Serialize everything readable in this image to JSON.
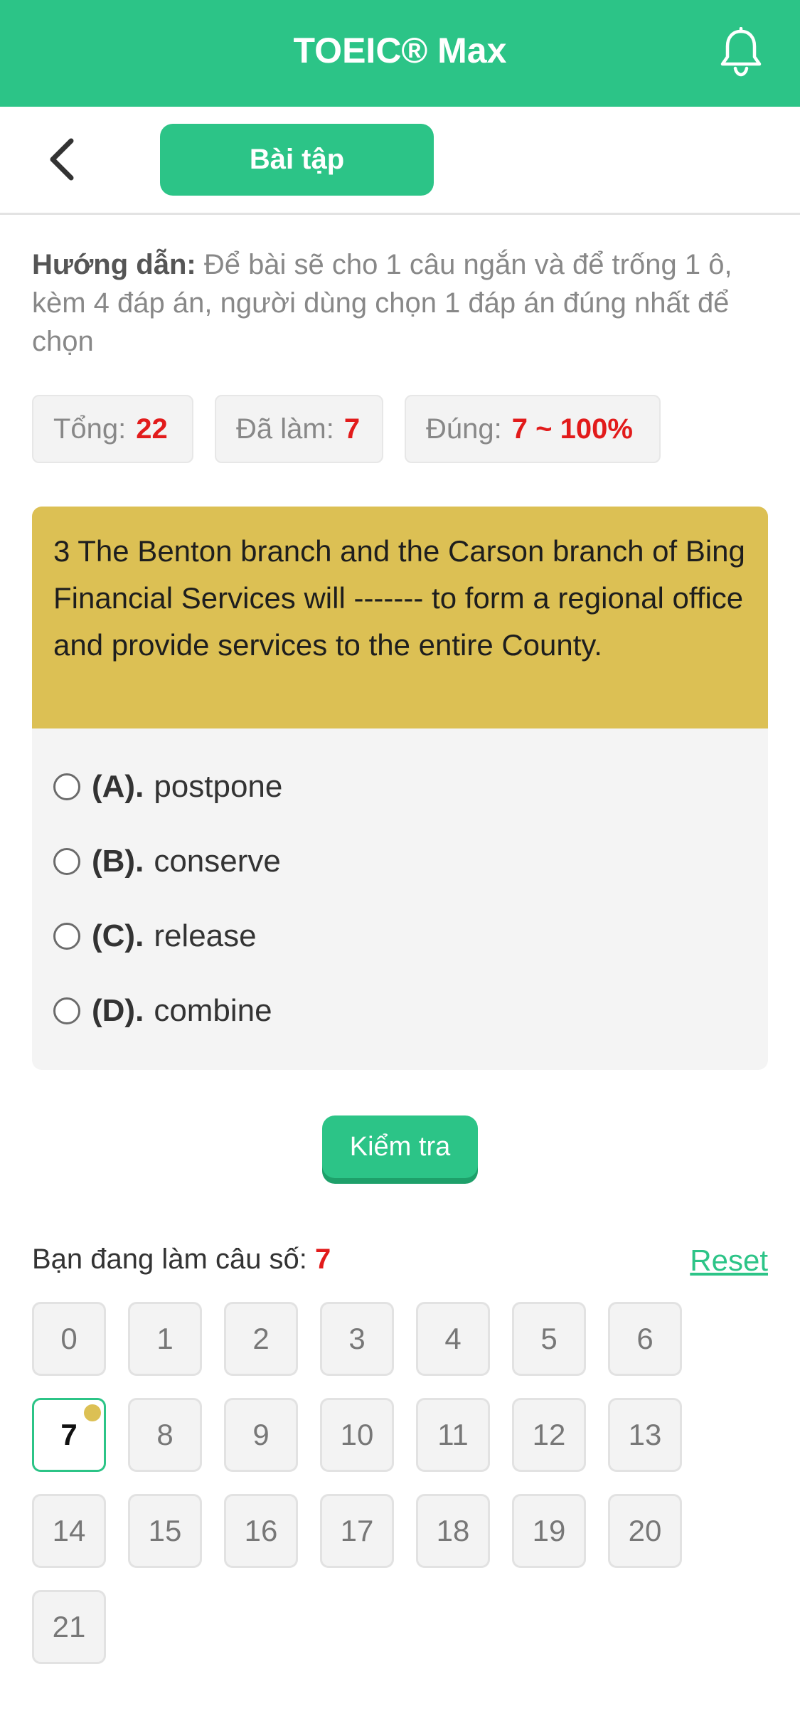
{
  "header": {
    "title": "TOEIC® Max",
    "bell_icon": "bell-icon"
  },
  "nav": {
    "back_icon": "chevron-left-icon",
    "tab_label": "Bài tập"
  },
  "guide": {
    "label": "Hướng dẫn:",
    "text": " Để bài sẽ cho 1 câu ngắn và để trống 1 ô, kèm 4 đáp án, người dùng chọn 1 đáp án đúng nhất để chọn"
  },
  "stats": {
    "total_label": "Tổng:",
    "total_value": "22",
    "done_label": "Đã làm:",
    "done_value": "7",
    "correct_label": "Đúng:",
    "correct_value": "7 ~ 100%"
  },
  "question": {
    "text": "3 The Benton branch and the Carson branch of Bing Financial Services will ------- to form a regional office and provide services to the entire County.",
    "options": [
      {
        "letter": "(A).",
        "text": "postpone"
      },
      {
        "letter": "(B).",
        "text": "conserve"
      },
      {
        "letter": "(C).",
        "text": "release"
      },
      {
        "letter": "(D).",
        "text": "combine"
      }
    ]
  },
  "check_button": "Kiểm tra",
  "progress": {
    "label": "Bạn đang làm câu số:",
    "current": "7",
    "reset_label": "Reset"
  },
  "question_numbers": [
    "0",
    "1",
    "2",
    "3",
    "4",
    "5",
    "6",
    "7",
    "8",
    "9",
    "10",
    "11",
    "12",
    "13",
    "14",
    "15",
    "16",
    "17",
    "18",
    "19",
    "20",
    "21"
  ],
  "colors": {
    "accent": "#2cc487",
    "question_bg": "#dcc054",
    "highlight": "#e21b1b"
  }
}
